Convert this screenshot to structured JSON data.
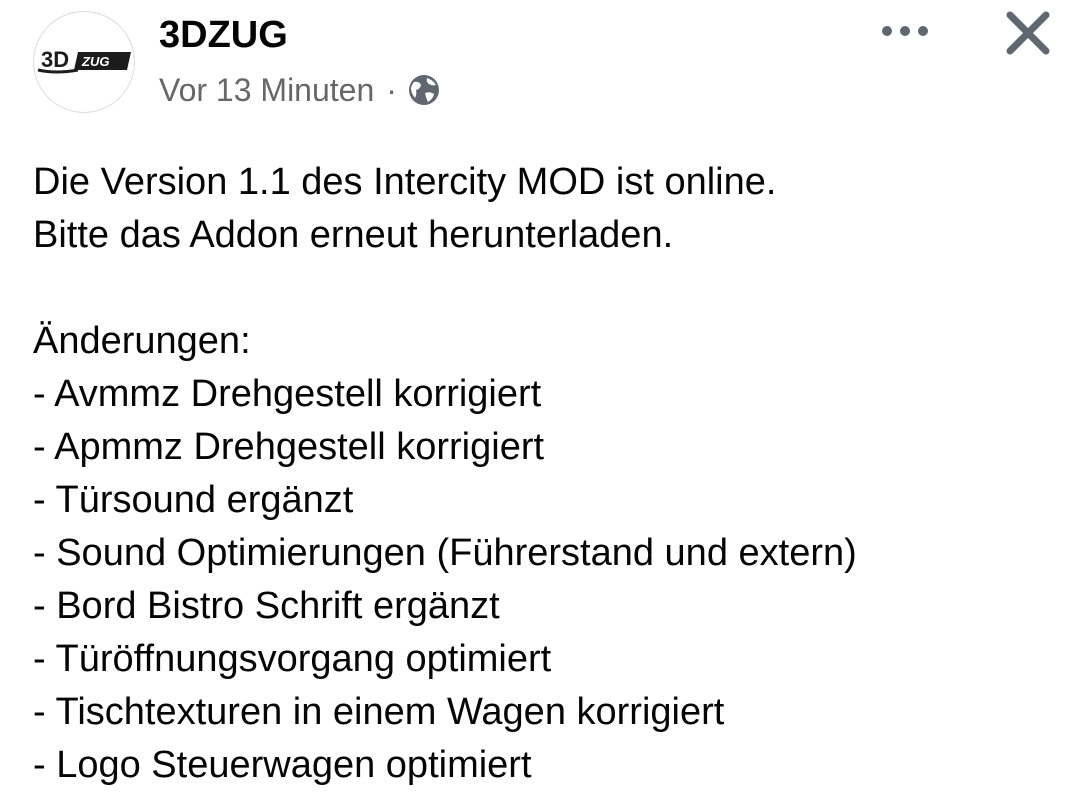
{
  "post": {
    "author": "3DZUG",
    "logo_text": {
      "left": "3D",
      "right": "ZUG"
    },
    "timestamp": "Vor 13 Minuten",
    "separator": "·",
    "privacy_icon": "globe-icon",
    "header_icons": {
      "more": "more-dots-icon",
      "close": "close-icon"
    },
    "lines": [
      "Die Version 1.1 des Intercity MOD ist online.",
      "Bitte das Addon erneut herunterladen.",
      "",
      "Änderungen:",
      "- Avmmz Drehgestell korrigiert",
      "- Apmmz Drehgestell korrigiert",
      "- Türsound ergänzt",
      "- Sound Optimierungen (Führerstand und extern)",
      "- Bord Bistro Schrift ergänzt",
      "- Türöffnungsvorgang optimiert",
      "- Tischtexturen in einem Wagen korrigiert",
      "- Logo Steuerwagen optimiert"
    ]
  },
  "colors": {
    "text": "#050505",
    "secondary_text": "#65676b",
    "icon": "#606770",
    "background": "#ffffff"
  }
}
